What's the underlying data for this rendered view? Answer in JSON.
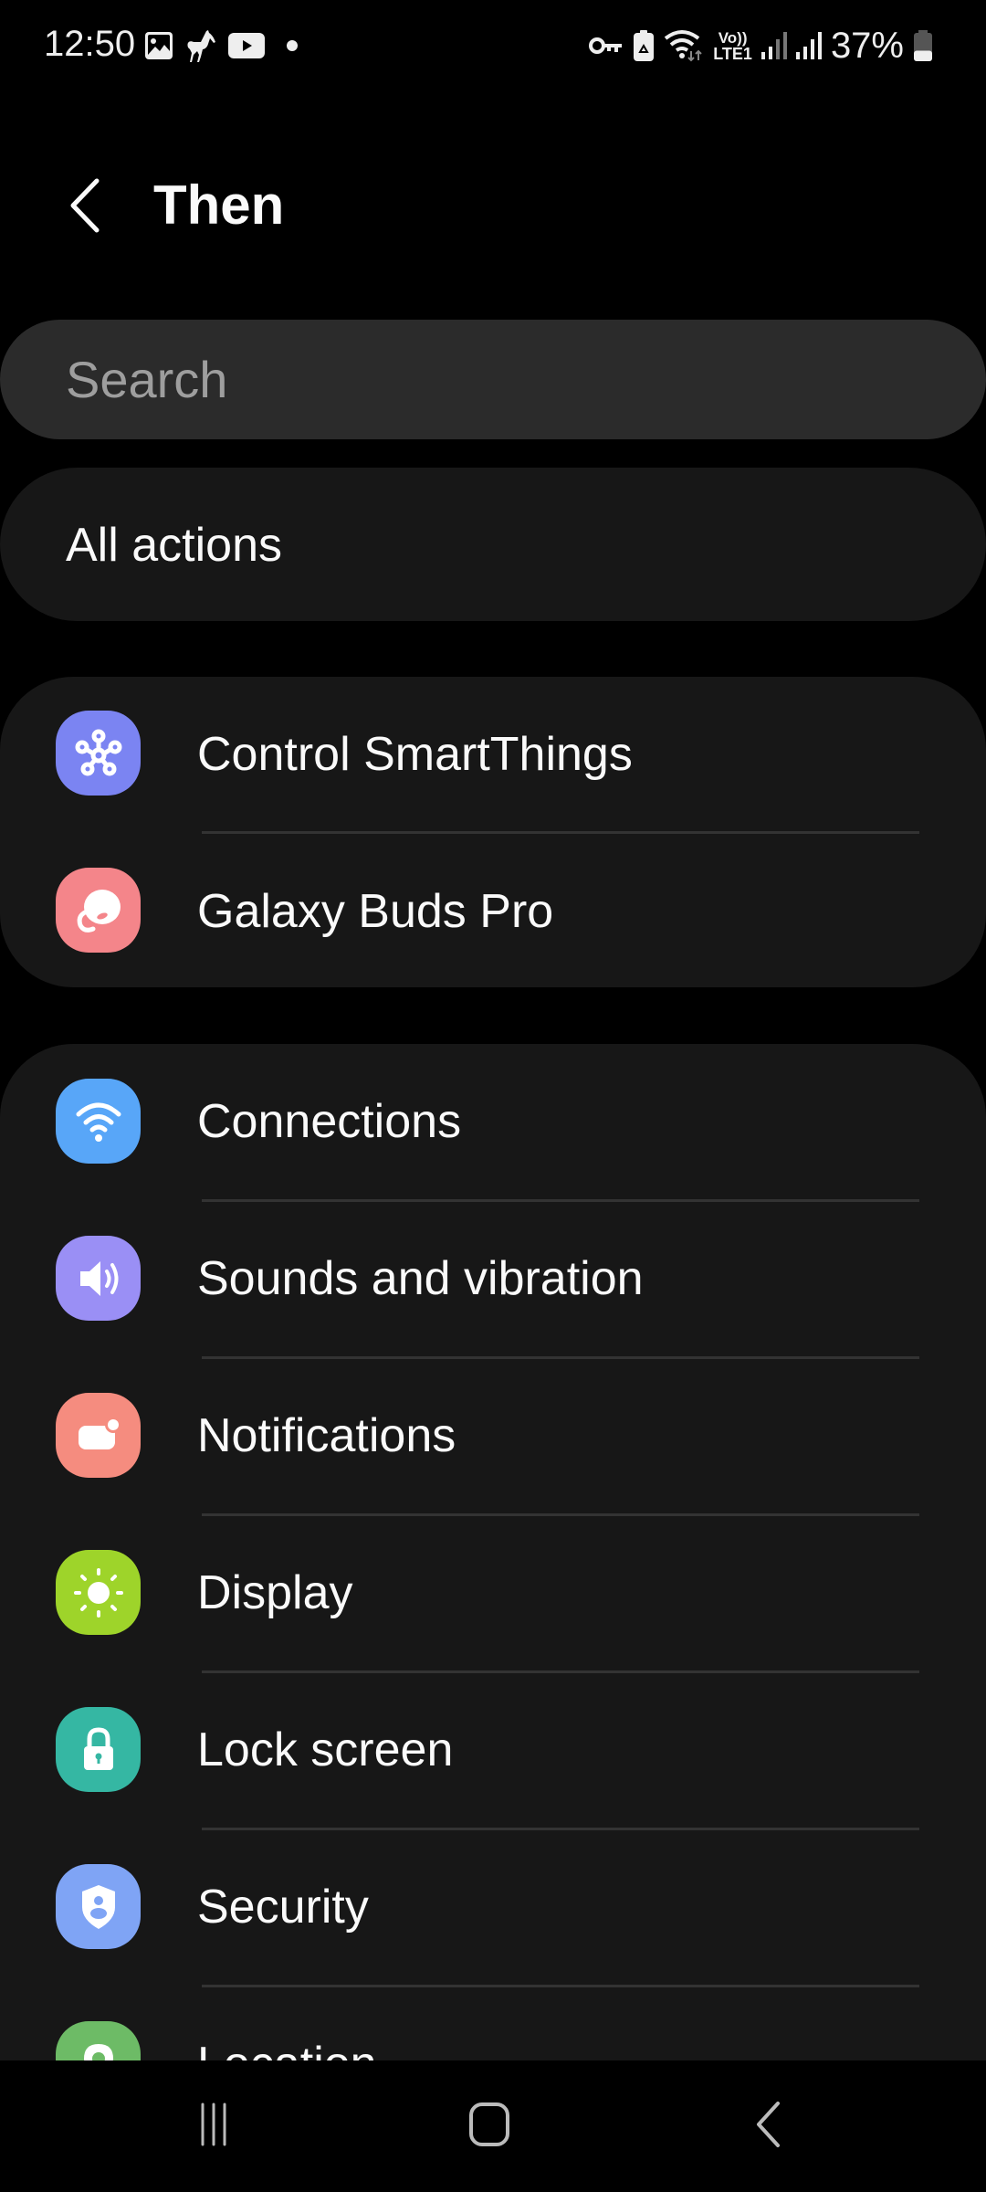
{
  "status_bar": {
    "time": "12:50",
    "left_icons": [
      "gallery-icon",
      "horse-app-icon",
      "youtube-icon",
      "notification-dot-icon"
    ],
    "right_icons": [
      "vpn-key-icon",
      "battery-saver-icon",
      "wifi-icon",
      "volte-lte1-icon",
      "signal-sim1-icon",
      "signal-sim2-icon"
    ],
    "volte_label_top": "Vo))",
    "volte_label_bottom": "LTE1",
    "battery_percent": "37%",
    "battery_level": 0.37
  },
  "header": {
    "back_icon": "chevron-left-icon",
    "title": "Then"
  },
  "search": {
    "placeholder": "Search",
    "value": ""
  },
  "all_actions": {
    "label": "All actions"
  },
  "sections": [
    {
      "items": [
        {
          "label": "Control SmartThings",
          "icon": "smartthings-icon",
          "color": "#7b84f2"
        },
        {
          "label": "Galaxy Buds Pro",
          "icon": "earbud-icon",
          "color": "#f4858a"
        }
      ]
    },
    {
      "items": [
        {
          "label": "Connections",
          "icon": "wifi-icon",
          "color": "#58a6f8"
        },
        {
          "label": "Sounds and vibration",
          "icon": "speaker-icon",
          "color": "#9a8ff5"
        },
        {
          "label": "Notifications",
          "icon": "notification-icon",
          "color": "#f58c7f"
        },
        {
          "label": "Display",
          "icon": "sun-icon",
          "color": "#9ed42a"
        },
        {
          "label": "Lock screen",
          "icon": "lock-icon",
          "color": "#35b7a3"
        },
        {
          "label": "Security",
          "icon": "shield-user-icon",
          "color": "#7fa4f5"
        },
        {
          "label": "Location",
          "icon": "location-pin-icon",
          "color": "#6dbb66"
        }
      ]
    }
  ],
  "nav_bar": {
    "recents_icon": "recents-icon",
    "home_icon": "home-icon",
    "back_icon": "back-icon"
  }
}
